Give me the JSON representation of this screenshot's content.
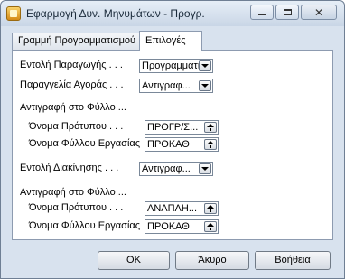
{
  "window": {
    "title": "Εφαρμογή Δυν. Μηνυμάτων - Προγρ.",
    "close_glyph": "✕"
  },
  "tabs": [
    {
      "label": "Γραμμή Προγραμματισμού",
      "active": false
    },
    {
      "label": "Επιλογές",
      "active": true
    }
  ],
  "form": {
    "production_order": {
      "label": "Εντολή Παραγωγής . . .",
      "value": "Προγραμματι",
      "button": "dropdown"
    },
    "purchase_order": {
      "label": "Παραγγελία Αγοράς . . .",
      "value": "Αντιγραφ...",
      "button": "dropdown"
    },
    "copy_to_sheet_1": {
      "label": "Αντιγραφή στο Φύλλο ..."
    },
    "template_name_1": {
      "label": "Όνομα Πρότυπου . . .",
      "value": "ΠΡΟΓΡ/Σ...",
      "button": "lookup"
    },
    "sheet_name_1": {
      "label": "Όνομα Φύλλου Εργασίας",
      "value": "ΠΡΟΚΑΘ",
      "button": "lookup"
    },
    "transfer_order": {
      "label": "Εντολή Διακίνησης . . .",
      "value": "Αντιγραφ...",
      "button": "dropdown"
    },
    "copy_to_sheet_2": {
      "label": "Αντιγραφή στο Φύλλο ..."
    },
    "template_name_2": {
      "label": "Όνομα Πρότυπου . . .",
      "value": "ΑΝΑΠΛΗ...",
      "button": "lookup"
    },
    "sheet_name_2": {
      "label": "Όνομα Φύλλου Εργασίας",
      "value": "ΠΡΟΚΑΘ",
      "button": "lookup"
    }
  },
  "buttons": {
    "ok": "OK",
    "cancel": "Άκυρο",
    "help": "Βοήθεια"
  }
}
